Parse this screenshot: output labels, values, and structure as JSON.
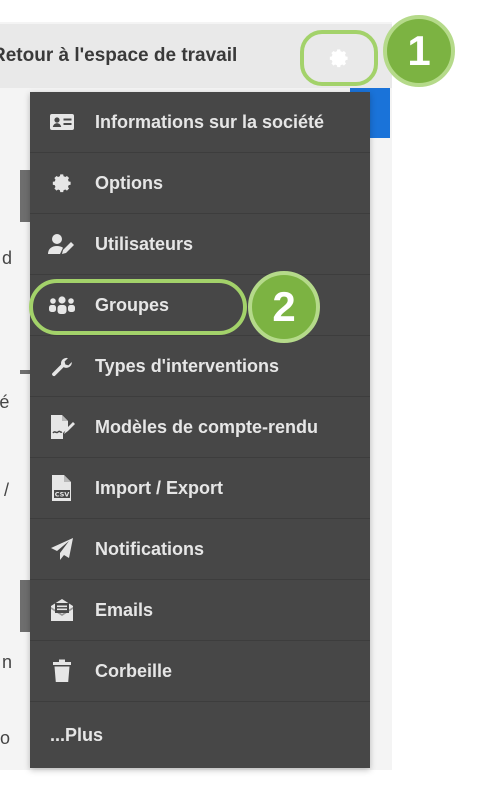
{
  "header": {
    "back_label": "Retour à l'espace de travail",
    "settings_icon": "gear-icon"
  },
  "background_fragments": [
    "d",
    "'é",
    "/",
    "n",
    "o"
  ],
  "menu": {
    "items": [
      {
        "label": "Informations sur la société",
        "icon": "id-card-icon"
      },
      {
        "label": "Options",
        "icon": "gear-icon"
      },
      {
        "label": "Utilisateurs",
        "icon": "user-edit-icon"
      },
      {
        "label": "Groupes",
        "icon": "users-icon"
      },
      {
        "label": "Types d'interventions",
        "icon": "wrench-icon"
      },
      {
        "label": "Modèles de compte-rendu",
        "icon": "file-signature-icon"
      },
      {
        "label": "Import / Export",
        "icon": "file-csv-icon"
      },
      {
        "label": "Notifications",
        "icon": "paper-plane-icon"
      },
      {
        "label": "Emails",
        "icon": "envelope-open-icon"
      },
      {
        "label": "Corbeille",
        "icon": "trash-icon"
      },
      {
        "label": "...Plus",
        "icon": ""
      }
    ]
  },
  "callouts": [
    {
      "number": "1"
    },
    {
      "number": "2"
    }
  ],
  "colors": {
    "menu_bg": "#474747",
    "menu_text": "#e6e6e6",
    "callout_green": "#7cb342",
    "callout_ring": "#a3d26a",
    "accent_blue": "#1a73d9"
  }
}
